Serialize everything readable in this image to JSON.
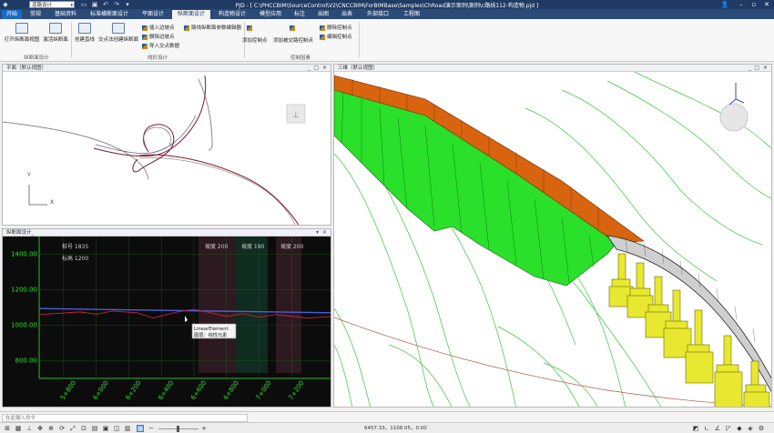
{
  "app": {
    "title": "PJD - [ C:\\PHCCBIM\\SourceControl\\V2\\CNCCBIM\\ForBIMBase\\Samples\\ChRoad演示案例\\案例\\c路线112-构造物.pjd ]",
    "mode_combo": "道路设计"
  },
  "menu": {
    "tabs": [
      "开始",
      "常规",
      "基础资料",
      "标准横断面设计",
      "平面设计",
      "纵断面设计",
      "构造物设计",
      "模型应用",
      "标注",
      "出图",
      "出表",
      "外部接口",
      "工程图"
    ],
    "active_index": 5
  },
  "ribbon": {
    "groups": [
      {
        "label": "纵断面设计",
        "buttons": [
          "打开纵断面视图",
          "激活纵断面"
        ]
      },
      {
        "label": "线形设计",
        "buttons": [
          "创建直线",
          "交点法创建纵断面",
          "插入边坡点",
          "删除边坡点",
          "导入交点数据",
          "路线纵断面参数编辑器"
        ]
      },
      {
        "label": "控制因素",
        "buttons": [
          "添加控制点",
          "添加被交路控制点",
          "删除控制点",
          "编辑控制点"
        ]
      }
    ]
  },
  "panels": {
    "plan": {
      "title": "平面（默认视图）",
      "axis_y": "Y",
      "axis_x": "X"
    },
    "profile": {
      "title": "纵断面设计_",
      "labels": [
        "桩号 1835",
        "标高 1200",
        "坡度 200",
        "坡度 190",
        "坡度 200"
      ],
      "tooltip_line1": "LinearElement",
      "tooltip_line2": "图层：线性元素"
    },
    "view3d": {
      "title": "三维（默认视图）"
    }
  },
  "chart_data": {
    "type": "line",
    "title": "",
    "xlabel": "",
    "ylabel": "",
    "y_ticks": [
      "1400.00",
      "1200.00",
      "1000.00",
      "800.00"
    ],
    "x_ticks": [
      "5+800",
      "6+000",
      "6+200",
      "6+400",
      "6+600",
      "6+800",
      "7+000",
      "7+200"
    ],
    "ylim": [
      700,
      1500
    ],
    "series": [
      {
        "color": "#4a5fe0",
        "x": [
          5650,
          7450
        ],
        "values": [
          1094,
          1070
        ]
      },
      {
        "color": "#c0263a",
        "x": [
          5650,
          5900,
          6000,
          6100,
          6250,
          6350,
          6500,
          6600,
          6700,
          6800,
          6900,
          7000,
          7100,
          7200,
          7300,
          7450
        ],
        "values": [
          1060,
          1075,
          1062,
          1080,
          1070,
          1040,
          1075,
          1090,
          1070,
          1050,
          1065,
          1045,
          1060,
          1050,
          1040,
          1050
        ]
      }
    ]
  },
  "cmdline": {
    "placeholder": "在此输入命令"
  },
  "status": {
    "coords": "6457.33，1108.05，0.00"
  },
  "colors": {
    "title_bg": "#1f3a63",
    "menu_bg": "#2b4a78",
    "profile_bg": "#0c0c0c",
    "terrain_line": "#39c639",
    "embankment": "#29e829",
    "road_surface": "#d86410",
    "pier": "#e8e830"
  }
}
